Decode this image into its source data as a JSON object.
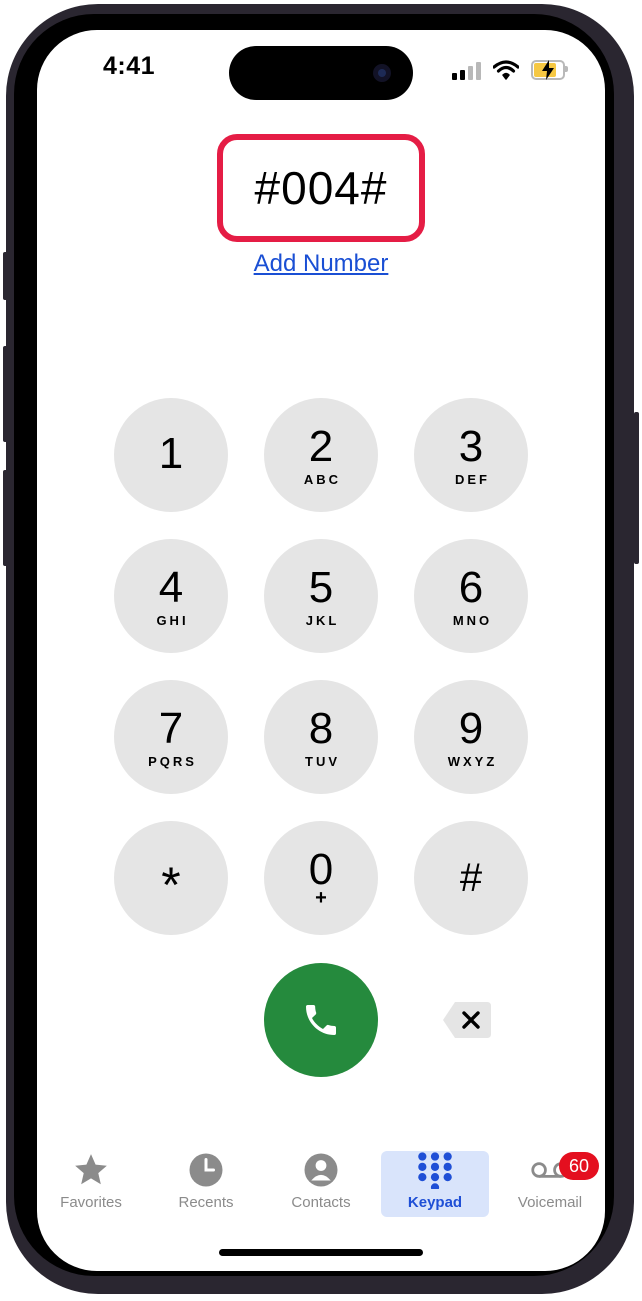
{
  "status_bar": {
    "time": "4:41"
  },
  "dialer": {
    "entered_number": "#004#",
    "add_number_link": "Add Number"
  },
  "keypad": {
    "rows": [
      [
        {
          "digit": "1",
          "letters": ""
        },
        {
          "digit": "2",
          "letters": "ABC"
        },
        {
          "digit": "3",
          "letters": "DEF"
        }
      ],
      [
        {
          "digit": "4",
          "letters": "GHI"
        },
        {
          "digit": "5",
          "letters": "JKL"
        },
        {
          "digit": "6",
          "letters": "MNO"
        }
      ],
      [
        {
          "digit": "7",
          "letters": "PQRS"
        },
        {
          "digit": "8",
          "letters": "TUV"
        },
        {
          "digit": "9",
          "letters": "WXYZ"
        }
      ],
      [
        {
          "digit": "*",
          "letters": ""
        },
        {
          "digit": "0",
          "letters": "+"
        },
        {
          "digit": "#",
          "letters": ""
        }
      ]
    ]
  },
  "tabs": [
    {
      "label": "Favorites",
      "icon": "star-icon"
    },
    {
      "label": "Recents",
      "icon": "clock-icon"
    },
    {
      "label": "Contacts",
      "icon": "person-icon"
    },
    {
      "label": "Keypad",
      "icon": "keypad-icon",
      "active": true
    },
    {
      "label": "Voicemail",
      "icon": "voicemail-icon",
      "badge": "60"
    }
  ],
  "colors": {
    "highlight_box": "#e51d45",
    "call_button": "#258a3d",
    "link": "#1a4fd4",
    "active_tab": "#1f4fd6",
    "badge": "#e40f1f"
  }
}
